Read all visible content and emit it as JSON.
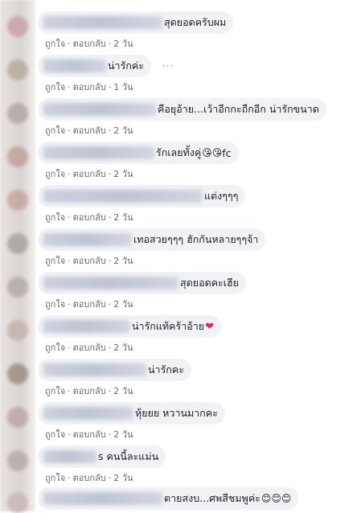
{
  "actions": {
    "like": "ถูกใจ",
    "reply": "ตอบกลับ",
    "dot": "·"
  },
  "comments": [
    {
      "text": "สุดยอดครับผม",
      "time": "2 วัน",
      "emoji": ""
    },
    {
      "text": "น่ารักค่ะ",
      "time": "1 วัน",
      "emoji": "",
      "more": "···"
    },
    {
      "text": "คือยุอ้าย...เว้าอีกกะถืกอีก น่ารักขนาด",
      "time": "2 วัน",
      "emoji": ""
    },
    {
      "text": "รักเลยทั้งคู่",
      "time": "2 วัน",
      "emoji": "😘😘",
      "suffix": "fc"
    },
    {
      "text": "แต่งๆๆๆ",
      "time": "2 วัน",
      "emoji": ""
    },
    {
      "text": "เทอสวยๆๆๆ ฮักกันหลายๆๆจ้า",
      "time": "2 วัน",
      "emoji": ""
    },
    {
      "text": "สุดยอดคะเฮีย",
      "time": "2 วัน",
      "emoji": ""
    },
    {
      "text": "น่ารักแท้คร้าอ้าย",
      "time": "2 วัน",
      "emoji": "❤"
    },
    {
      "text": "น่ารักคะ",
      "time": "2 วัน",
      "emoji": ""
    },
    {
      "text": "หุ้ยยย หวานมากคะ",
      "time": "2 วัน",
      "emoji": ""
    },
    {
      "text": "s คนนี้ละแม่น",
      "time": "2 วัน",
      "emoji": ""
    },
    {
      "text": "ตายสงบ...ศพสีชมพูค่ะ",
      "time": "",
      "emoji": "😊😊😊"
    }
  ]
}
